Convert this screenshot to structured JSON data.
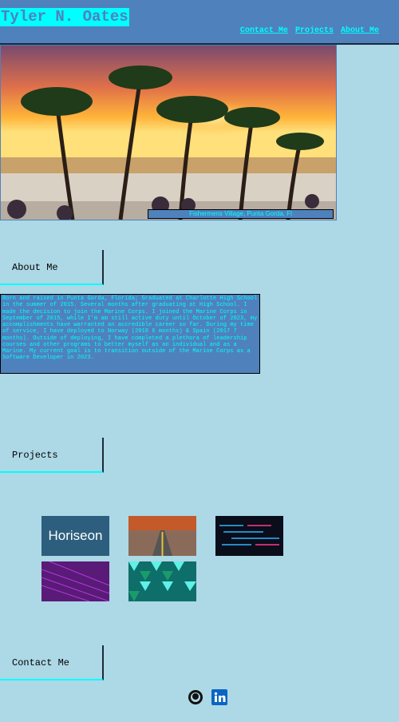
{
  "header": {
    "title": "Tyler N. Oates",
    "nav": [
      "Contact Me",
      "Projects",
      "About Me"
    ]
  },
  "hero": {
    "caption": "Fishermens Village, Punta Gorda, Fl"
  },
  "about": {
    "heading": "About Me",
    "text": "Born and raised in Punta Gorda, Florida; Graduated at Charlotte High School in the summer of 2015. Several months after graduating at High School. I made the decision to join the Marine Corps. I joined the Marine Corps in September of 2015, while I'm am still active duty until October of 2023, my accomplishments have warranted an accredible career so far. During my time of service, I have deployed to Norway (2018 6 months) & Spain (2017 7 months). Outside of deploying, I have completed a plethora of leadership courses and other programs to better myself as an individual and as a Marine. My current goal is to transition outside of the Marine Corps as a Software Developer in 2023."
  },
  "projects": {
    "heading": "Projects",
    "items": [
      {
        "label": "Horiseon"
      }
    ]
  },
  "contact": {
    "heading": "Contact Me",
    "icons": [
      "github-icon",
      "linkedin-icon"
    ]
  },
  "colors": {
    "background": "#add8e6",
    "header": "#4f81bd",
    "accent": "#00ffff"
  }
}
